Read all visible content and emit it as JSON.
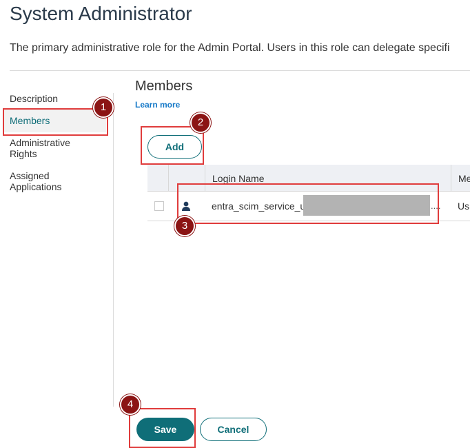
{
  "page": {
    "title": "System Administrator",
    "description": "The primary administrative role for the Admin Portal. Users in this role can delegate specifi"
  },
  "sidebar": {
    "items": [
      {
        "label": "Description",
        "active": false
      },
      {
        "label": "Members",
        "active": true
      },
      {
        "label": "Administrative Rights",
        "active": false
      },
      {
        "label": "Assigned Applications",
        "active": false
      }
    ]
  },
  "members": {
    "title": "Members",
    "learn_more": "Learn more",
    "add_label": "Add",
    "table": {
      "columns": [
        "Login Name",
        "Me"
      ],
      "rows": [
        {
          "login_name": "entra_scim_service_u",
          "ellipsis": "....",
          "col2": "Us"
        }
      ]
    }
  },
  "footer": {
    "save_label": "Save",
    "cancel_label": "Cancel"
  },
  "annotations": {
    "badges": [
      "1",
      "2",
      "3",
      "4"
    ]
  },
  "colors": {
    "accent": "#0f6e78",
    "link": "#1478c7",
    "highlight": "#e03c3c",
    "badge": "#8b1414"
  }
}
